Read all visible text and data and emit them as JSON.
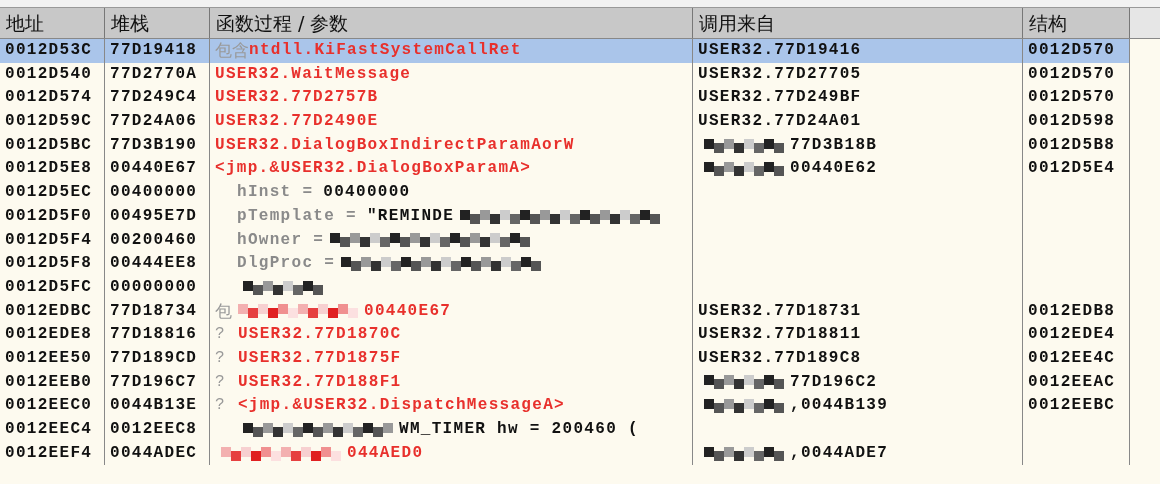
{
  "table": {
    "columns": [
      "地址",
      "堆栈",
      "函数过程 / 参数",
      "调用来自",
      "结构"
    ],
    "rows": [
      {
        "address": "0012D53C",
        "stack": "77D19418",
        "procedure": {
          "kind": "call",
          "prefix": "包含",
          "name": "ntdll.KiFastSystemCallRet"
        },
        "called_from": {
          "text": "USER32.77D19416",
          "redacted": false
        },
        "frame": "0012D570",
        "selected": true
      },
      {
        "address": "0012D540",
        "stack": "77D2770A",
        "procedure": {
          "kind": "call",
          "name": "USER32.WaitMessage"
        },
        "called_from": {
          "text": "USER32.77D27705",
          "redacted": false
        },
        "frame": "0012D570",
        "selected": false
      },
      {
        "address": "0012D574",
        "stack": "77D249C4",
        "procedure": {
          "kind": "call",
          "name": "USER32.77D2757B"
        },
        "called_from": {
          "text": "USER32.77D249BF",
          "redacted": false
        },
        "frame": "0012D570",
        "selected": false
      },
      {
        "address": "0012D59C",
        "stack": "77D24A06",
        "procedure": {
          "kind": "call",
          "name": "USER32.77D2490E"
        },
        "called_from": {
          "text": "USER32.77D24A01",
          "redacted": false
        },
        "frame": "0012D598",
        "selected": false
      },
      {
        "address": "0012D5BC",
        "stack": "77D3B190",
        "procedure": {
          "kind": "call",
          "name": "USER32.DialogBoxIndirectParamAorW"
        },
        "called_from": {
          "text": "77D3B18B",
          "redacted": true
        },
        "frame": "0012D5B8",
        "selected": false
      },
      {
        "address": "0012D5E8",
        "stack": "00440E67",
        "procedure": {
          "kind": "call",
          "name": "<jmp.&USER32.DialogBoxParamA>"
        },
        "called_from": {
          "text": "00440E62",
          "redacted": true
        },
        "frame": "0012D5E4",
        "selected": false
      },
      {
        "address": "0012D5EC",
        "stack": "00400000",
        "procedure": {
          "kind": "param",
          "param": "hInst =",
          "value": "00400000",
          "redacted": false
        },
        "selected": false
      },
      {
        "address": "0012D5F0",
        "stack": "00495E7D",
        "procedure": {
          "kind": "param",
          "param": "pTemplate =",
          "value": "\"REMINDE",
          "redacted": true
        },
        "selected": false
      },
      {
        "address": "0012D5F4",
        "stack": "00200460",
        "procedure": {
          "kind": "param",
          "param": "hOwner =",
          "redacted": true
        },
        "selected": false
      },
      {
        "address": "0012D5F8",
        "stack": "00444EE8",
        "procedure": {
          "kind": "param",
          "param": "DlgProc =",
          "redacted": true
        },
        "selected": false
      },
      {
        "address": "0012D5FC",
        "stack": "00000000",
        "procedure": {
          "kind": "param",
          "redacted": true
        },
        "selected": false
      },
      {
        "address": "0012EDBC",
        "stack": "77D18734",
        "procedure": {
          "kind": "call",
          "prefix": "包",
          "name": "00440E67",
          "redacted": true
        },
        "called_from": {
          "text": "USER32.77D18731",
          "redacted": false
        },
        "frame": "0012EDB8",
        "selected": false
      },
      {
        "address": "0012EDE8",
        "stack": "77D18816",
        "procedure": {
          "kind": "call",
          "prefix": "?",
          "name": "USER32.77D1870C"
        },
        "called_from": {
          "text": "USER32.77D18811",
          "redacted": false
        },
        "frame": "0012EDE4",
        "selected": false
      },
      {
        "address": "0012EE50",
        "stack": "77D189CD",
        "procedure": {
          "kind": "call",
          "prefix": "?",
          "name": "USER32.77D1875F"
        },
        "called_from": {
          "text": "USER32.77D189C8",
          "redacted": false
        },
        "frame": "0012EE4C",
        "selected": false
      },
      {
        "address": "0012EEB0",
        "stack": "77D196C7",
        "procedure": {
          "kind": "call",
          "prefix": "?",
          "name": "USER32.77D188F1"
        },
        "called_from": {
          "text": "77D196C2",
          "redacted": true
        },
        "frame": "0012EEAC",
        "selected": false
      },
      {
        "address": "0012EEC0",
        "stack": "0044B13E",
        "procedure": {
          "kind": "call",
          "prefix": "?",
          "name": "<jmp.&USER32.DispatchMessageA>"
        },
        "called_from": {
          "text": ",0044B139",
          "redacted": true
        },
        "frame": "0012EEBC",
        "selected": false
      },
      {
        "address": "0012EEC4",
        "stack": "0012EEC8",
        "procedure": {
          "kind": "param",
          "value": "WM_TIMER hw = 200460 (",
          "redacted": true
        },
        "selected": false
      },
      {
        "address": "0012EEF4",
        "stack": "0044ADEC",
        "procedure": {
          "kind": "call",
          "name": "044AED0",
          "redacted": true
        },
        "called_from": {
          "text": ",0044ADE7",
          "redacted": true
        },
        "selected": false
      }
    ]
  }
}
